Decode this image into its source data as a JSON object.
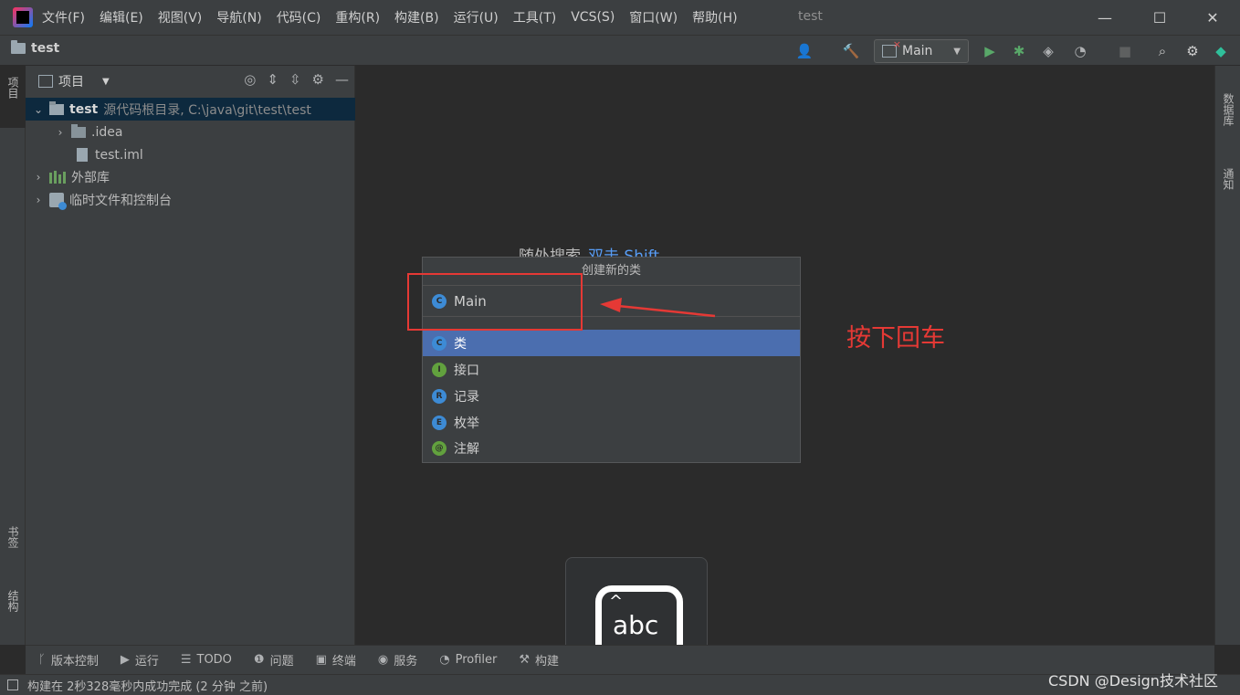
{
  "window": {
    "title": "test",
    "minimize": "—",
    "maximize": "☐",
    "close": "✕"
  },
  "menu": [
    "文件(F)",
    "编辑(E)",
    "视图(V)",
    "导航(N)",
    "代码(C)",
    "重构(R)",
    "构建(B)",
    "运行(U)",
    "工具(T)",
    "VCS(S)",
    "窗口(W)",
    "帮助(H)"
  ],
  "navbar": {
    "project_name": "test",
    "run_config": "Main"
  },
  "left_stripe": {
    "project": "项目",
    "bookmarks": "书签",
    "structure": "结构"
  },
  "right_stripe": {
    "database": "数据库",
    "notifications": "通知"
  },
  "project_panel": {
    "title": "项目",
    "tree": [
      {
        "label": "test",
        "detail": "源代码根目录, C:\\java\\git\\test\\test"
      },
      {
        "label": ".idea"
      },
      {
        "label": "test.iml"
      },
      {
        "label": "外部库"
      },
      {
        "label": "临时文件和控制台"
      }
    ]
  },
  "editor": {
    "hint_text": "随处搜索",
    "hint_shortcut": "双击 Shift"
  },
  "new_class_popup": {
    "title": "创建新的类",
    "input_value": "Main",
    "options": [
      {
        "badge": "C",
        "label": "类",
        "color": "#3d8bd5"
      },
      {
        "badge": "I",
        "label": "接口",
        "color": "#62a13e"
      },
      {
        "badge": "R",
        "label": "记录",
        "color": "#3d8bd5"
      },
      {
        "badge": "E",
        "label": "枚举",
        "color": "#3d8bd5"
      },
      {
        "badge": "@",
        "label": "注解",
        "color": "#62a13e"
      }
    ]
  },
  "annotation": {
    "text": "按下回车",
    "color": "#e53935"
  },
  "keyboard_overlay": {
    "label": "abc",
    "caret": "^"
  },
  "bottom_tools": [
    "版本控制",
    "运行",
    "TODO",
    "问题",
    "终端",
    "服务",
    "Profiler",
    "构建"
  ],
  "status": {
    "message": "构建在 2秒328毫秒内成功完成 (2 分钟 之前)"
  },
  "watermark": "CSDN @Design技术社区"
}
